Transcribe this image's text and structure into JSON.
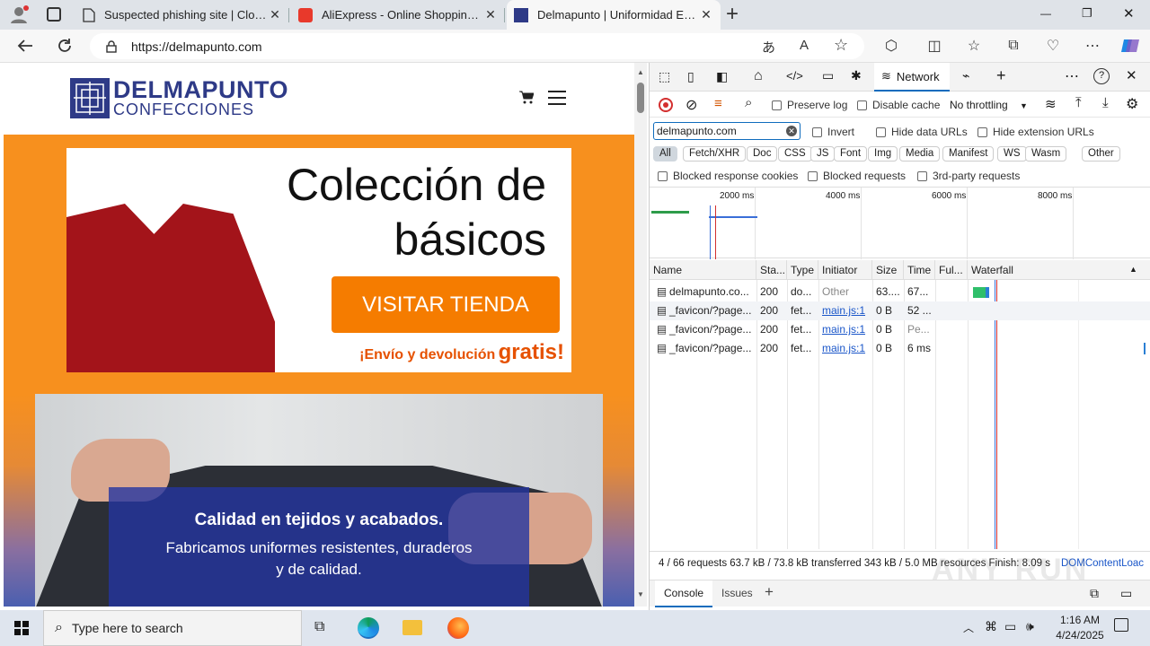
{
  "browser": {
    "tabs": [
      {
        "title": "Suspected phishing site | Cloudfl",
        "close": "✕"
      },
      {
        "title": "AliExpress - Online Shopping für",
        "close": "✕"
      },
      {
        "title": "Delmapunto | Uniformidad Escol",
        "close": "✕"
      }
    ],
    "new_tab": "+",
    "url": "https://delmapunto.com",
    "window_controls": [
      "—",
      "❐",
      "✕"
    ]
  },
  "site": {
    "logo_main": "DELMAPUNTO",
    "logo_sub": "CONFECCIONES",
    "banner": {
      "heading_line1": "Colección de",
      "heading_line2": "básicos",
      "button": "VISITAR TIENDA",
      "note_prefix": "¡Envío y devolución",
      "note_emphasis": "gratis!"
    },
    "hero": {
      "title": "Calidad en tejidos y acabados.",
      "subtitle_line1": "Fabricamos uniformes resistentes, duraderos",
      "subtitle_line2": "y de calidad."
    },
    "accent": "#f7901e"
  },
  "devtools": {
    "network_tab": "Network",
    "preserve_log": "Preserve log",
    "disable_cache": "Disable cache",
    "throttling": "No throttling",
    "filter_value": "delmapunto.com",
    "invert": "Invert",
    "hide_data_urls": "Hide data URLs",
    "hide_ext_urls": "Hide extension URLs",
    "type_filters": [
      "All",
      "Fetch/XHR",
      "Doc",
      "CSS",
      "JS",
      "Font",
      "Img",
      "Media",
      "Manifest",
      "WS",
      "Wasm",
      "Other"
    ],
    "blocked_cookies": "Blocked response cookies",
    "blocked_requests": "Blocked requests",
    "third_party": "3rd-party requests",
    "timeline_ticks": [
      "2000 ms",
      "4000 ms",
      "6000 ms",
      "8000 ms"
    ],
    "columns": [
      "Name",
      "Sta...",
      "Type",
      "Initiator",
      "Size",
      "Time",
      "Ful...",
      "Waterfall"
    ],
    "rows": [
      {
        "name": "delmapunto.co...",
        "status": "200",
        "type": "do...",
        "initiator": "Other",
        "size": "63....",
        "time": "67..."
      },
      {
        "name": "_favicon/?page...",
        "status": "200",
        "type": "fet...",
        "initiator": "main.js:1",
        "size": "0 B",
        "time": "52 ..."
      },
      {
        "name": "_favicon/?page...",
        "status": "200",
        "type": "fet...",
        "initiator": "main.js:1",
        "size": "0 B",
        "time": "Pe..."
      },
      {
        "name": "_favicon/?page...",
        "status": "200",
        "type": "fet...",
        "initiator": "main.js:1",
        "size": "0 B",
        "time": "6 ms"
      }
    ],
    "summary": "4 / 66 requests   63.7 kB / 73.8 kB transferred   343 kB / 5.0 MB resources   Finish: 8.09 s",
    "summary_tail": "DOMContentLoac",
    "drawer_tabs": [
      "Console",
      "Issues"
    ]
  },
  "taskbar": {
    "search_placeholder": "Type here to search",
    "time": "1:16 AM",
    "date": "4/24/2025"
  },
  "watermark": "ANY RUN"
}
